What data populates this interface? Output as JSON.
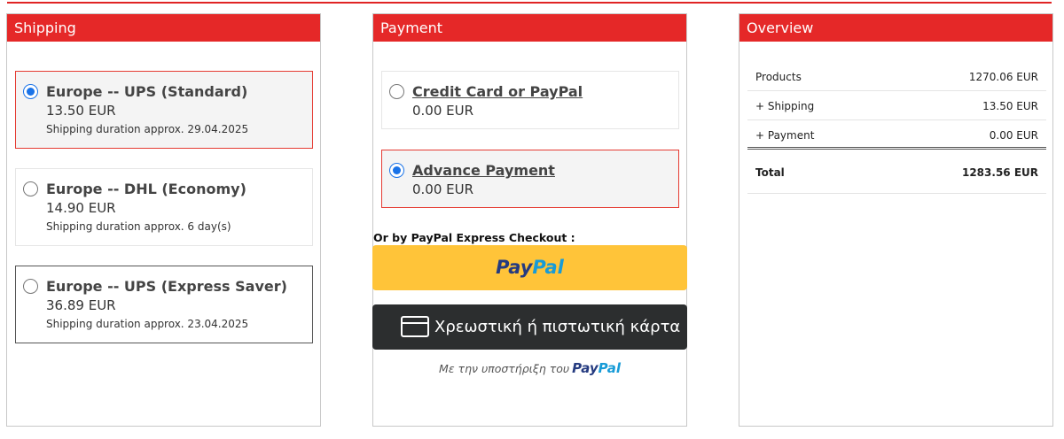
{
  "shipping": {
    "title": "Shipping",
    "options": [
      {
        "name": "Europe -- UPS (Standard)",
        "price": "13.50 EUR",
        "duration": "Shipping duration approx. 29.04.2025",
        "selected": true
      },
      {
        "name": "Europe -- DHL (Economy)",
        "price": "14.90 EUR",
        "duration": "Shipping duration approx. 6 day(s)",
        "selected": false
      },
      {
        "name": "Europe -- UPS (Express Saver)",
        "price": "36.89 EUR",
        "duration": "Shipping duration approx. 23.04.2025",
        "selected": false
      }
    ]
  },
  "payment": {
    "title": "Payment",
    "options": [
      {
        "name": "Credit Card or PayPal",
        "price": "0.00 EUR",
        "selected": false
      },
      {
        "name": "Advance Payment",
        "price": "0.00 EUR",
        "selected": true
      }
    ],
    "express_label": "Or by PayPal Express Checkout :",
    "paypal_logo_pay": "Pay",
    "paypal_logo_pal": "Pal",
    "card_button_label": "Χρεωστική ή πιστωτική κάρτα",
    "powered_by": "Με την υποστήριξη του"
  },
  "overview": {
    "title": "Overview",
    "rows": [
      {
        "label": "Products",
        "value": "1270.06 EUR"
      },
      {
        "label": "+ Shipping",
        "value": "13.50 EUR"
      },
      {
        "label": "+ Payment",
        "value": "0.00 EUR"
      }
    ],
    "total_label": "Total",
    "total_value": "1283.56 EUR"
  },
  "colors": {
    "accent_red": "#e52828",
    "selected_radio": "#1a73e8",
    "paypal_yellow": "#ffc439",
    "card_button_dark": "#2c2e2f"
  }
}
